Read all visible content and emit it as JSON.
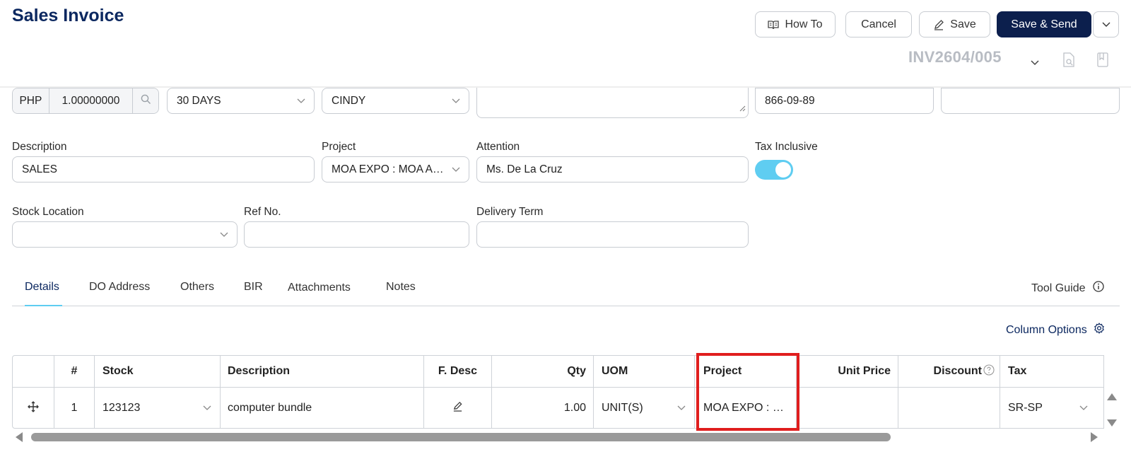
{
  "header": {
    "title": "Sales Invoice",
    "buttons": {
      "how_to": "How To",
      "cancel": "Cancel",
      "save": "Save",
      "save_send": "Save & Send"
    },
    "invoice_no": "INV2604/005"
  },
  "top_row": {
    "currency": "PHP",
    "exchange_rate": "1.00000000",
    "terms": "30 DAYS",
    "agent": "CINDY",
    "phone": "866-09-89",
    "extra": ""
  },
  "form": {
    "description_label": "Description",
    "description_value": "SALES",
    "project_label": "Project",
    "project_value": "MOA EXPO : MOA AR...",
    "attention_label": "Attention",
    "attention_value": "Ms. De La Cruz",
    "tax_inclusive_label": "Tax Inclusive",
    "tax_inclusive_on": true,
    "stock_location_label": "Stock Location",
    "stock_location_value": "",
    "ref_no_label": "Ref No.",
    "ref_no_value": "",
    "delivery_term_label": "Delivery Term",
    "delivery_term_value": ""
  },
  "tabs": {
    "details": "Details",
    "do_address": "DO Address",
    "others": "Others",
    "bir": "BIR",
    "attachments": "Attachments",
    "notes": "Notes",
    "active": "details"
  },
  "tool_guide": "Tool Guide",
  "column_options": "Column Options",
  "table": {
    "headers": {
      "num": "#",
      "stock": "Stock",
      "description": "Description",
      "f_desc": "F. Desc",
      "qty": "Qty",
      "uom": "UOM",
      "project": "Project",
      "unit_price": "Unit Price",
      "discount": "Discount",
      "tax": "Tax"
    },
    "rows": [
      {
        "num": "1",
        "stock": "123123",
        "description": "computer bundle",
        "qty": "1.00",
        "uom": "UNIT(S)",
        "project": "MOA EXPO : M...",
        "unit_price": "",
        "discount": "",
        "tax": "SR-SP"
      }
    ]
  },
  "colors": {
    "brand": "#0c2860",
    "toggle": "#5fcdf1",
    "highlight": "#e01e1e"
  }
}
